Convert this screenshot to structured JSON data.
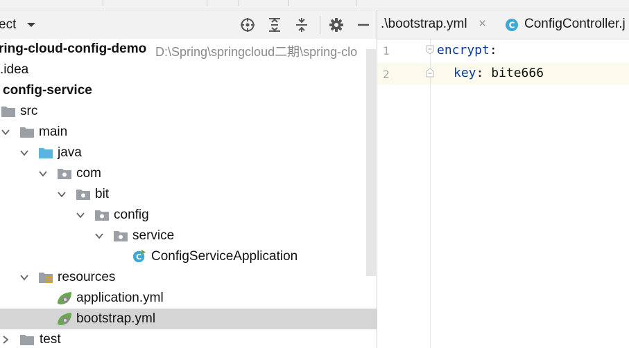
{
  "project_panel": {
    "title": "ect",
    "toolbar_icons": [
      "crosshair-icon",
      "expand-all-icon",
      "collapse-all-icon",
      "gear-icon",
      "minimize-icon"
    ]
  },
  "tree": [
    {
      "label": "ring-cloud-config-demo",
      "path": "D:\\Spring\\springcloud二期\\spring-clo",
      "icon": "module-folder-icon",
      "bold": true
    },
    {
      "label": ".idea",
      "icon": "folder-icon"
    },
    {
      "label": "config-service",
      "icon": "module-folder-icon",
      "bold": true
    },
    {
      "label": "src",
      "icon": "folder-icon"
    },
    {
      "label": "main",
      "icon": "folder-icon"
    },
    {
      "label": "java",
      "icon": "source-folder-icon"
    },
    {
      "label": "com",
      "icon": "package-icon"
    },
    {
      "label": "bit",
      "icon": "package-icon"
    },
    {
      "label": "config",
      "icon": "package-icon"
    },
    {
      "label": "service",
      "icon": "package-icon"
    },
    {
      "label": "ConfigServiceApplication",
      "icon": "spring-class-icon"
    },
    {
      "label": "resources",
      "icon": "resources-folder-icon"
    },
    {
      "label": "application.yml",
      "icon": "spring-yml-icon"
    },
    {
      "label": "bootstrap.yml",
      "icon": "spring-yml-icon",
      "selected": true
    },
    {
      "label": "test",
      "icon": "folder-icon"
    }
  ],
  "editor": {
    "tabs": [
      {
        "label": ".\\bootstrap.yml",
        "close": "×",
        "active": true
      },
      {
        "label": "ConfigController.j",
        "icon": "class-icon"
      }
    ],
    "lines": [
      {
        "number": "1",
        "key": "encrypt",
        "sep": ":",
        "value": ""
      },
      {
        "number": "2",
        "key": "key",
        "sep": ":",
        "value": " bite666"
      }
    ]
  },
  "colors": {
    "accent": "#3fa9d6",
    "spring_green": "#6aa84f",
    "folder_gray": "#9aa0a6",
    "selection": "#d5d5d5",
    "yaml_key": "#0b3a95"
  }
}
